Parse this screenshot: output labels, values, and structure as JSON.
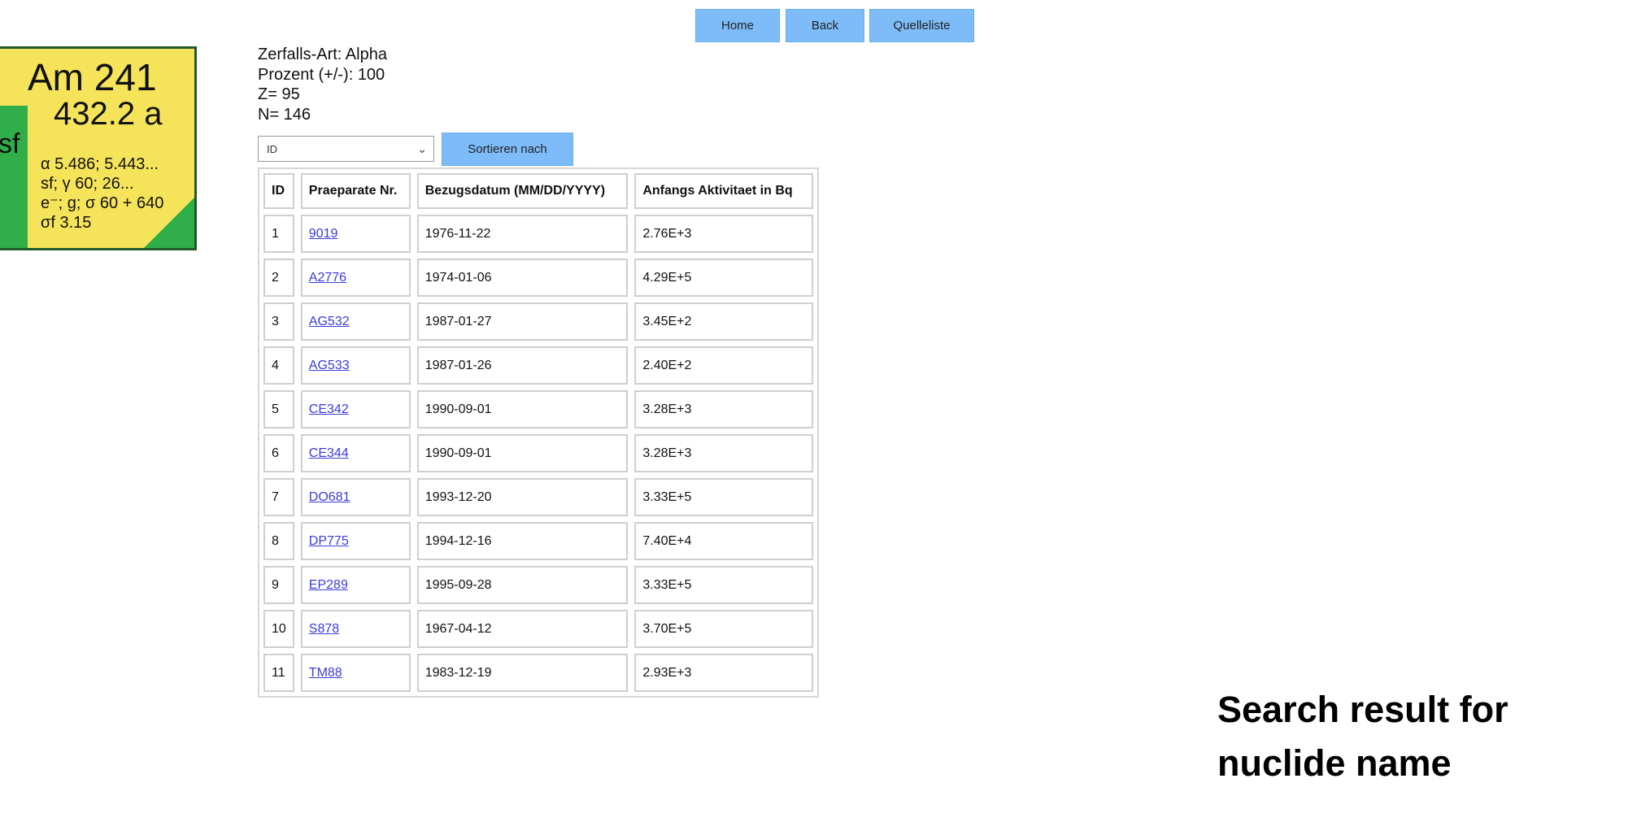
{
  "nuclide": {
    "name": "Am 241",
    "half_life": "432.2 a",
    "side_label": "sf",
    "lines": [
      "α 5.486; 5.443...",
      "sf; γ 60; 26...",
      "e⁻; g; σ 60 + 640",
      "σf 3.15"
    ],
    "colors": {
      "yellow": "#f5e35a",
      "green": "#2fae4a"
    }
  },
  "nav": {
    "home": "Home",
    "back": "Back",
    "source_list": "Quelleliste"
  },
  "info": {
    "decay_type": "Zerfalls-Art: Alpha",
    "percent": "Prozent (+/-): 100",
    "z": "Z= 95",
    "n": "N= 146"
  },
  "sort": {
    "selected": "ID",
    "button": "Sortieren nach"
  },
  "table": {
    "headers": [
      "ID",
      "Praeparate Nr.",
      "Bezugsdatum (MM/DD/YYYY)",
      "Anfangs Aktivitaet in Bq"
    ],
    "rows": [
      {
        "id": "1",
        "nr": "9019",
        "date": "1976-11-22",
        "activity": "2.76E+3"
      },
      {
        "id": "2",
        "nr": "A2776",
        "date": "1974-01-06",
        "activity": "4.29E+5"
      },
      {
        "id": "3",
        "nr": "AG532",
        "date": "1987-01-27",
        "activity": "3.45E+2"
      },
      {
        "id": "4",
        "nr": "AG533",
        "date": "1987-01-26",
        "activity": "2.40E+2"
      },
      {
        "id": "5",
        "nr": "CE342",
        "date": "1990-09-01",
        "activity": "3.28E+3"
      },
      {
        "id": "6",
        "nr": "CE344",
        "date": "1990-09-01",
        "activity": "3.28E+3"
      },
      {
        "id": "7",
        "nr": "DO681",
        "date": "1993-12-20",
        "activity": "3.33E+5"
      },
      {
        "id": "8",
        "nr": "DP775",
        "date": "1994-12-16",
        "activity": "7.40E+4"
      },
      {
        "id": "9",
        "nr": "EP289",
        "date": "1995-09-28",
        "activity": "3.33E+5"
      },
      {
        "id": "10",
        "nr": "S878",
        "date": "1967-04-12",
        "activity": "3.70E+5"
      },
      {
        "id": "11",
        "nr": "TM88",
        "date": "1983-12-19",
        "activity": "2.93E+3"
      }
    ]
  },
  "caption": {
    "line1": "Search result for",
    "line2": "nuclide name"
  }
}
